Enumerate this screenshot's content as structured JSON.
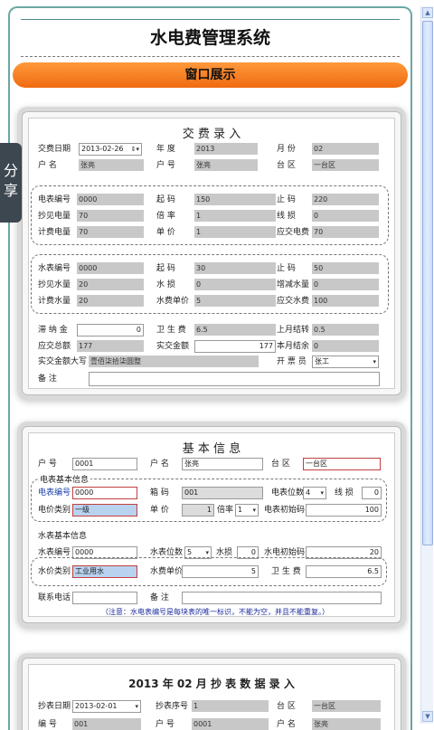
{
  "app_title": "水电费管理系统",
  "section_bar": "窗口展示",
  "share_tab": "分享",
  "payment": {
    "title": "交  费  录  入",
    "date_label": "交费日期",
    "date": "2013-02-26",
    "year_label": "年  度",
    "year": "2013",
    "month_label": "月  份",
    "month": "02",
    "name_label": "户  名",
    "name": "张亮",
    "account_label": "户  号",
    "account": "张亮",
    "zone_label": "台  区",
    "zone": "一台区",
    "meter_no_label": "电表编号",
    "meter_no": "0000",
    "e_start_label": "起  码",
    "e_start": "150",
    "e_end_label": "止  码",
    "e_end": "220",
    "e_read_label": "抄见电量",
    "e_read": "70",
    "e_ratio_label": "倍  率",
    "e_ratio": "1",
    "e_loss_label": "线  损",
    "e_loss": "0",
    "e_billed_label": "计费电量",
    "e_billed": "70",
    "e_price_label": "单  价",
    "e_price": "1",
    "e_due_label": "应交电费",
    "e_due": "70",
    "w_no_label": "水表编号",
    "w_no": "0000",
    "w_start_label": "起  码",
    "w_start": "30",
    "w_end_label": "止  码",
    "w_end": "50",
    "w_read_label": "抄见水量",
    "w_read": "20",
    "w_loss_label": "水  损",
    "w_loss": "0",
    "w_adjust_label": "增减水量",
    "w_adjust": "0",
    "w_billed_label": "计费水量",
    "w_billed": "20",
    "w_price_label": "水费单价",
    "w_price": "5",
    "w_due_label": "应交水费",
    "w_due": "100",
    "late_label": "滞 纳 金",
    "late": "0",
    "hygiene_label": "卫 生 费",
    "hygiene": "6.5",
    "last_balance_label": "上月结转",
    "last_balance": "0.5",
    "total_label": "应交总额",
    "total": "177",
    "paid_label": "实交金额",
    "paid": "177",
    "balance_label": "本月结余",
    "balance": "0",
    "uppercase_label": "实交金额大写",
    "uppercase": "壹佰柒拾柒圆整",
    "issuer_label": "开 票 员",
    "issuer": "张工",
    "remark_label": "备      注",
    "remark": ""
  },
  "basic": {
    "title": "基 本 信 息",
    "account_label": "户  号",
    "account": "0001",
    "name_label": "户  名",
    "name": "张亮",
    "zone_label": "台  区",
    "zone": "一台区",
    "elec_group": "电表基本信息",
    "e_no_label": "电表编号",
    "e_no": "0000",
    "box_label": "箱  码",
    "box": "001",
    "e_digits_label": "电表位数",
    "e_digits": "4",
    "loss_label": "线 损",
    "loss": "0",
    "price_type_label": "电价类别",
    "price_type": "一级",
    "unit_label": "单  价",
    "unit": "1",
    "ratio_label": "倍率",
    "ratio": "1",
    "e_init_label": "电表初始码",
    "e_init": "100",
    "water_group": "水表基本信息",
    "w_no_label": "水表编号",
    "w_no": "0000",
    "w_digits_label": "水表位数",
    "w_digits": "5",
    "w_loss_label": "水损",
    "w_loss": "0",
    "w_init_label": "水电初始码",
    "w_init": "20",
    "w_type_label": "水价类别",
    "w_type": "工业用水",
    "w_price_label": "水费单价",
    "w_price": "5",
    "hygiene_label": "卫 生 费",
    "hygiene": "6.5",
    "phone_label": "联系电话",
    "phone": "",
    "remark_label": "备  注",
    "remark": "",
    "note": "（注意：水电表编号是每块表的唯一标识，不能为空，并且不能重复。）"
  },
  "reading": {
    "title": "2013  年  02  月  抄  表  数  据  录  入",
    "date_label": "抄表日期",
    "date": "2013-02-01",
    "seq_label": "抄表序号",
    "seq": "1",
    "zone_label": "台  区",
    "zone": "一台区",
    "row2_label1": "编  号",
    "row2_val1": "001",
    "row2_label2": "户  号",
    "row2_val2": "0001",
    "row2_label3": "户  名",
    "row2_val3": "张亮"
  }
}
